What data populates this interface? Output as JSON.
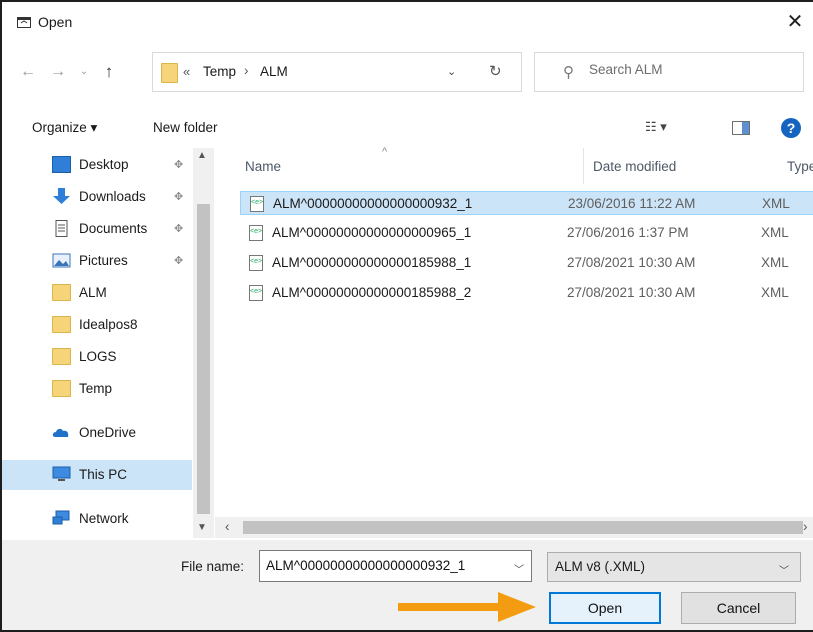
{
  "window": {
    "title": "Open",
    "close_glyph": "✕"
  },
  "nav_buttons": {
    "back": "←",
    "forward": "→",
    "recent": "⌄",
    "up": "↑"
  },
  "address": {
    "chevron": "«",
    "crumbs": [
      "Temp",
      "ALM"
    ],
    "separator": "›",
    "dropdown": "⌄",
    "refresh": "↻"
  },
  "search": {
    "placeholder": "Search ALM",
    "icon": "search-icon"
  },
  "toolbar": {
    "organize_label": "Organize ▾",
    "new_folder_label": "New folder",
    "view_glyph": "☷ ▾",
    "help_glyph": "?"
  },
  "nav_pane": {
    "items": [
      {
        "label": "Desktop",
        "icon": "desktop-icon",
        "pinned": true
      },
      {
        "label": "Downloads",
        "icon": "downloads-icon",
        "pinned": true
      },
      {
        "label": "Documents",
        "icon": "documents-icon",
        "pinned": true
      },
      {
        "label": "Pictures",
        "icon": "pictures-icon",
        "pinned": true
      },
      {
        "label": "ALM",
        "icon": "folder-icon",
        "pinned": false
      },
      {
        "label": "Idealpos8",
        "icon": "folder-icon",
        "pinned": false
      },
      {
        "label": "LOGS",
        "icon": "folder-icon",
        "pinned": false
      },
      {
        "label": "Temp",
        "icon": "folder-icon",
        "pinned": false
      },
      {
        "label": "OneDrive",
        "icon": "onedrive-icon",
        "pinned": false
      },
      {
        "label": "This PC",
        "icon": "this-pc-icon",
        "pinned": false,
        "selected": true
      },
      {
        "label": "Network",
        "icon": "network-icon",
        "pinned": false
      }
    ]
  },
  "file_list": {
    "columns": {
      "name": "Name",
      "date": "Date modified",
      "type": "Type"
    },
    "rows": [
      {
        "name": "ALM^00000000000000000932_1",
        "date": "23/06/2016 11:22 AM",
        "type": "XML",
        "selected": true
      },
      {
        "name": "ALM^00000000000000000965_1",
        "date": "27/06/2016 1:37 PM",
        "type": "XML",
        "selected": false
      },
      {
        "name": "ALM^00000000000000185988_1",
        "date": "27/08/2021 10:30 AM",
        "type": "XML",
        "selected": false
      },
      {
        "name": "ALM^00000000000000185988_2",
        "date": "27/08/2021 10:30 AM",
        "type": "XML",
        "selected": false
      }
    ]
  },
  "bottom": {
    "file_name_label": "File name:",
    "file_name_value": "ALM^00000000000000000932_1",
    "file_type_value": "ALM v8 (.XML)",
    "open_label": "Open",
    "cancel_label": "Cancel"
  },
  "colors": {
    "selection": "#cce4f7",
    "accent": "#0078d7",
    "arrow": "#f39c12",
    "folder": "#f6d57a"
  }
}
